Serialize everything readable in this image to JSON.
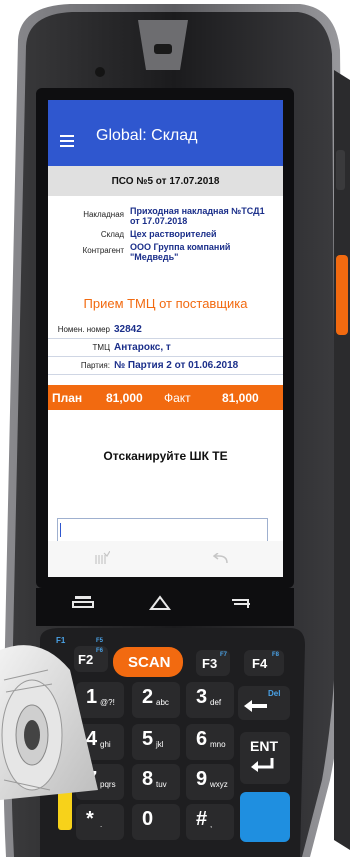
{
  "app": {
    "title": "Global: Склад"
  },
  "document": {
    "header": "ПСО №5 от 17.07.2018"
  },
  "info": [
    {
      "label": "Накладная",
      "value": "Приходная накладная №ТСД1 от 17.07.2018"
    },
    {
      "label": "Склад",
      "value": "Цех растворителей"
    },
    {
      "label": "Контрагент",
      "value": "ООО Группа компаний \"Медведь\""
    }
  ],
  "section": {
    "title": "Прием ТМЦ от поставщика"
  },
  "details": [
    {
      "label": "Номен. номер",
      "value": "32842"
    },
    {
      "label": "ТМЦ",
      "value": "Антарокс, т"
    },
    {
      "label": "Партия:",
      "value": "№ Партия 2 от 01.06.2018"
    }
  ],
  "plan": {
    "plan_label": "План",
    "plan_value": "81,000",
    "fact_label": "Факт",
    "fact_value": "81,000"
  },
  "instruction": "Отсканируйте ШК ТЕ",
  "scan_input": {
    "value": ""
  },
  "toolbar": {
    "barcode_icon": "barcode-icon",
    "undo_icon": "undo-icon"
  },
  "keypad": {
    "scan_label": "SCAN",
    "f1_label": "F1",
    "f2_label": "F2",
    "f3_label": "F3",
    "f4_label": "F4",
    "f5_label": "F5",
    "f6_label": "F6",
    "f7_label": "F7",
    "f8_label": "F8",
    "del_label": "Del",
    "ent_label": "ENT",
    "keys": [
      {
        "num": "1",
        "sub": "@?!"
      },
      {
        "num": "2",
        "sub": "abc"
      },
      {
        "num": "3",
        "sub": "def"
      },
      {
        "num": "4",
        "sub": "ghi"
      },
      {
        "num": "5",
        "sub": "jkl"
      },
      {
        "num": "6",
        "sub": "mno"
      },
      {
        "num": "7",
        "sub": "pqrs"
      },
      {
        "num": "8",
        "sub": "tuv"
      },
      {
        "num": "9",
        "sub": "wxyz"
      },
      {
        "num": "*",
        "sub": "."
      },
      {
        "num": "0",
        "sub": ""
      },
      {
        "num": "#",
        "sub": ","
      }
    ]
  },
  "colors": {
    "appbar": "#2f57cf",
    "accent": "#f26a10",
    "value_text": "#1b2f8a",
    "scan_key": "#f26a10",
    "device_body": "#2a2a2c"
  }
}
